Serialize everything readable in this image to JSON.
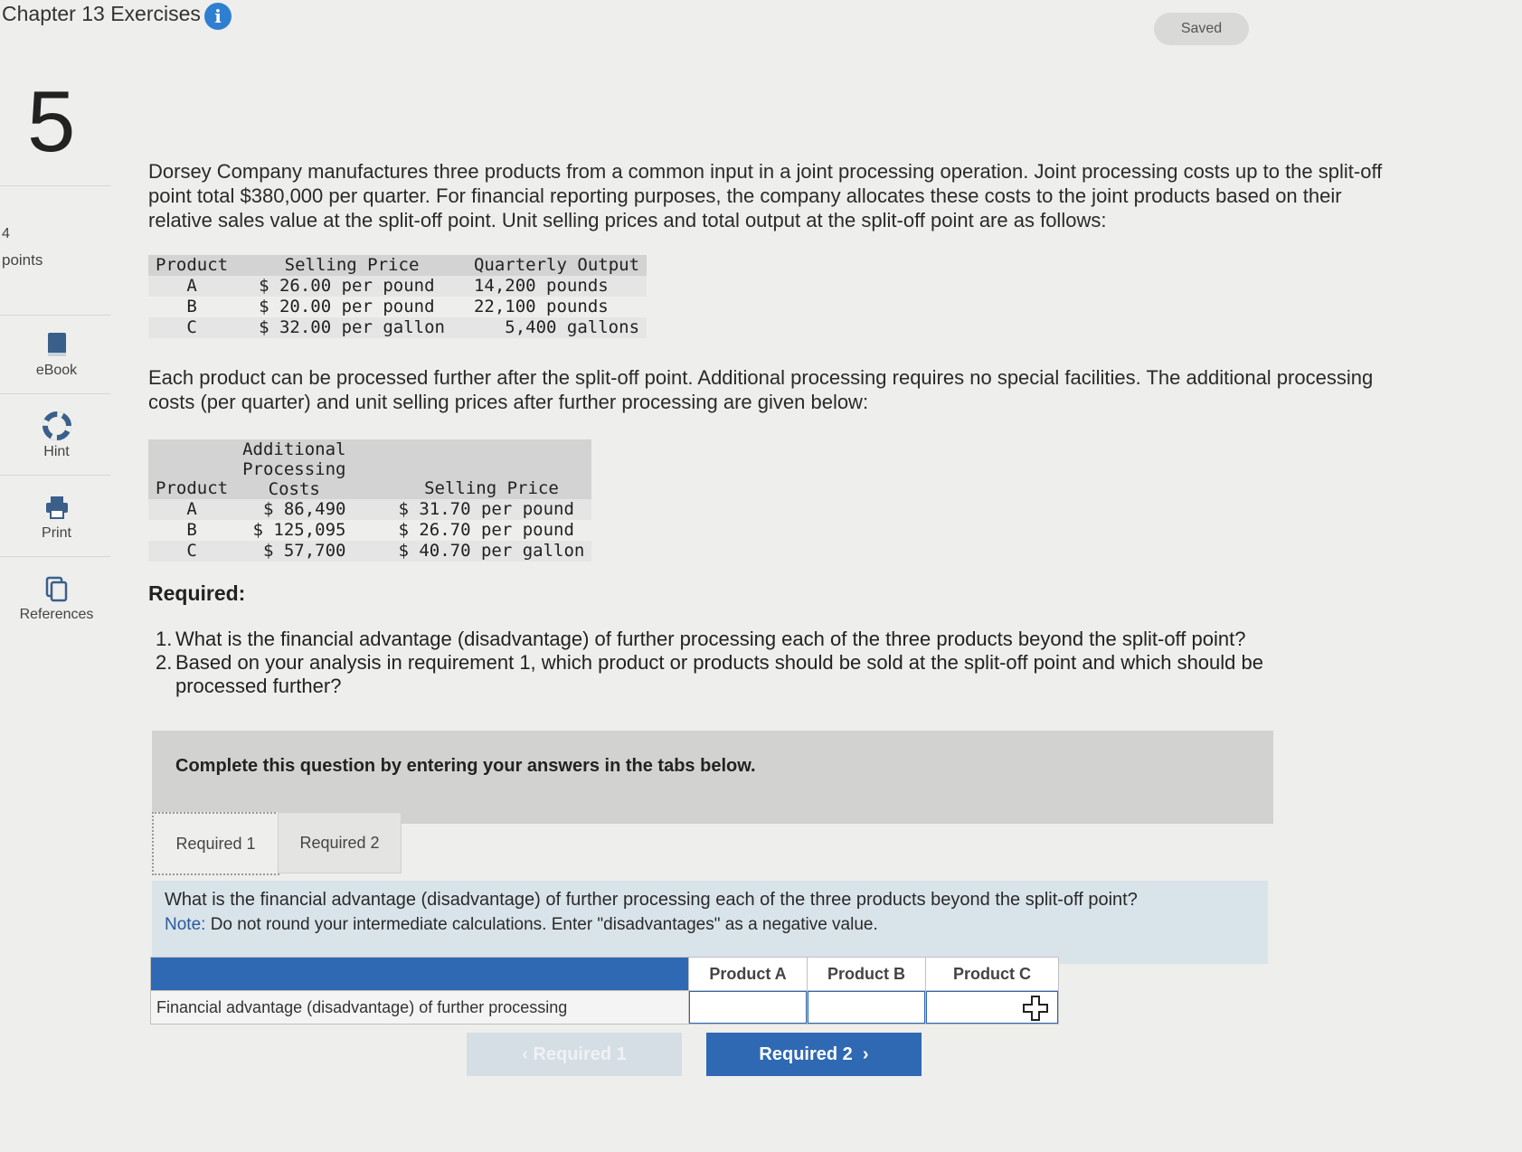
{
  "header": {
    "chapter_title": "Chapter 13 Exercises",
    "info_icon": "info-icon",
    "saved_label": "Saved"
  },
  "sidebar": {
    "question_number": "5",
    "points_value": "4",
    "points_label": "points",
    "items": [
      {
        "label": "eBook",
        "icon": "book-icon"
      },
      {
        "label": "Hint",
        "icon": "lifebuoy-icon"
      },
      {
        "label": "Print",
        "icon": "printer-icon"
      },
      {
        "label": "References",
        "icon": "documents-icon"
      }
    ]
  },
  "problem": {
    "intro": "Dorsey Company manufactures three products from a common input in a joint processing operation. Joint processing costs up to the split-off point total $380,000 per quarter. For financial reporting purposes, the company allocates these costs to the joint products based on their relative sales value at the split-off point. Unit selling prices and total output at the split-off point are as follows:",
    "table1": {
      "headers": [
        "Product",
        "Selling Price",
        "Quarterly Output"
      ],
      "rows": [
        [
          "A",
          "$ 26.00 per pound",
          "14,200 pounds"
        ],
        [
          "B",
          "$ 20.00 per pound",
          "22,100 pounds"
        ],
        [
          "C",
          "$ 32.00 per gallon",
          "5,400 gallons"
        ]
      ]
    },
    "further": "Each product can be processed further after the split-off point. Additional processing requires no special facilities. The additional processing costs (per quarter) and unit selling prices after further processing are given below:",
    "table2": {
      "headers": [
        "Product",
        "Additional Processing Costs",
        "Selling Price"
      ],
      "header_lines": [
        "Additional",
        "Processing",
        "Costs"
      ],
      "rows": [
        [
          "A",
          "$ 86,490",
          "$ 31.70 per pound"
        ],
        [
          "B",
          "$ 125,095",
          "$ 26.70 per pound"
        ],
        [
          "C",
          "$ 57,700",
          "$ 40.70 per gallon"
        ]
      ]
    },
    "required_heading": "Required:",
    "requirements": [
      {
        "num": "1.",
        "text": "What is the financial advantage (disadvantage) of further processing each of the three products beyond the split-off point?"
      },
      {
        "num": "2.",
        "text": "Based on your analysis in requirement 1, which product or products should be sold at the split-off point and which should be processed further?"
      }
    ]
  },
  "answer_area": {
    "instruction": "Complete this question by entering your answers in the tabs below.",
    "tabs": [
      "Required 1",
      "Required 2"
    ],
    "active_tab": "Required 1",
    "question": "What is the financial advantage (disadvantage) of further processing each of the three products beyond the split-off point?",
    "note_label": "Note:",
    "note": "Do not round your intermediate calculations. Enter \"disadvantages\" as a negative value.",
    "table": {
      "columns": [
        "Product A",
        "Product B",
        "Product C"
      ],
      "row_label": "Financial advantage (disadvantage) of further processing",
      "values": [
        "",
        "",
        ""
      ]
    },
    "prev_button": "Required 1",
    "next_button": "Required 2"
  },
  "colors": {
    "accent": "#2f69b3",
    "info": "#2f7fd0",
    "instruction_bg": "#d9e3ea"
  }
}
